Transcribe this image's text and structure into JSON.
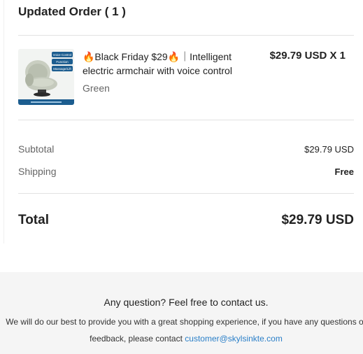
{
  "order": {
    "title": "Updated Order ( 1 )",
    "item": {
      "name_line1": "🔥Black Friday $29🔥｜Intelligent",
      "name_line2": "electric armchair with voice control",
      "variant": "Green",
      "price": "$29.79 USD X 1",
      "image_icon": "armchair-product-image",
      "image_badges": [
        "Voice Control",
        "Function",
        "Massage/Lift"
      ]
    }
  },
  "summary": {
    "subtotal_label": "Subtotal",
    "subtotal_value": "$29.79 USD",
    "shipping_label": "Shipping",
    "shipping_value": "Free",
    "total_label": "Total",
    "total_value": "$29.79 USD"
  },
  "footer": {
    "heading": "Any question? Feel free to contact us.",
    "text_line1": "We will do our best to provide you with a great shopping experience, if you have any questions or",
    "text_line2_prefix": "feedback, please contact ",
    "email": "customer@skylsinkte.com"
  },
  "colors": {
    "link": "#2a7fc8",
    "footer_background": "#f5f5f5",
    "divider": "#e2e2e2",
    "muted_text": "#666666"
  }
}
